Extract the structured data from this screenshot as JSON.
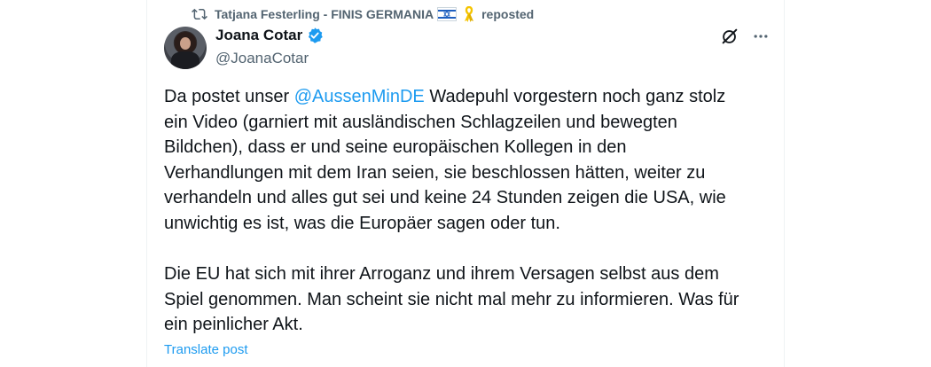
{
  "repost": {
    "reposter_name": "Tatjana Festerling - FINIS GERMANIA",
    "suffix": "reposted",
    "icon": "repost-icon",
    "flag_icon": "israel-flag-icon",
    "ribbon_icon": "yellow-ribbon-icon"
  },
  "author": {
    "display_name": "Joana Cotar",
    "handle": "@JoanaCotar",
    "verified_icon": "verified-badge-icon",
    "verified_color": "#1d9bf0"
  },
  "actions": {
    "grok_icon": "grok-icon",
    "more_icon": "more-icon"
  },
  "post": {
    "p1_before": "Da postet unser ",
    "p1_mention": "@AussenMinDE",
    "p1_after": " Wadepuhl vorgestern noch ganz stolz\nein Video (garniert mit ausländischen Schlagzeilen und bewegten\nBildchen), dass er und seine europäischen Kollegen in den\nVerhandlungen mit dem Iran seien, sie beschlossen hätten, weiter zu\nverhandeln und alles gut sei und keine 24 Stunden zeigen die USA, wie\nunwichtig es ist, was die Europäer sagen oder tun.",
    "p2": "Die EU hat sich mit ihrer Arroganz und ihrem Versagen selbst aus dem\nSpiel genommen. Man scheint sie nicht mal mehr zu informieren. Was für\nein peinlicher Akt."
  },
  "translate_label": "Translate post",
  "colors": {
    "text": "#0f1419",
    "secondary": "#536471",
    "accent": "#1d9bf0",
    "border": "#eff3f4"
  }
}
